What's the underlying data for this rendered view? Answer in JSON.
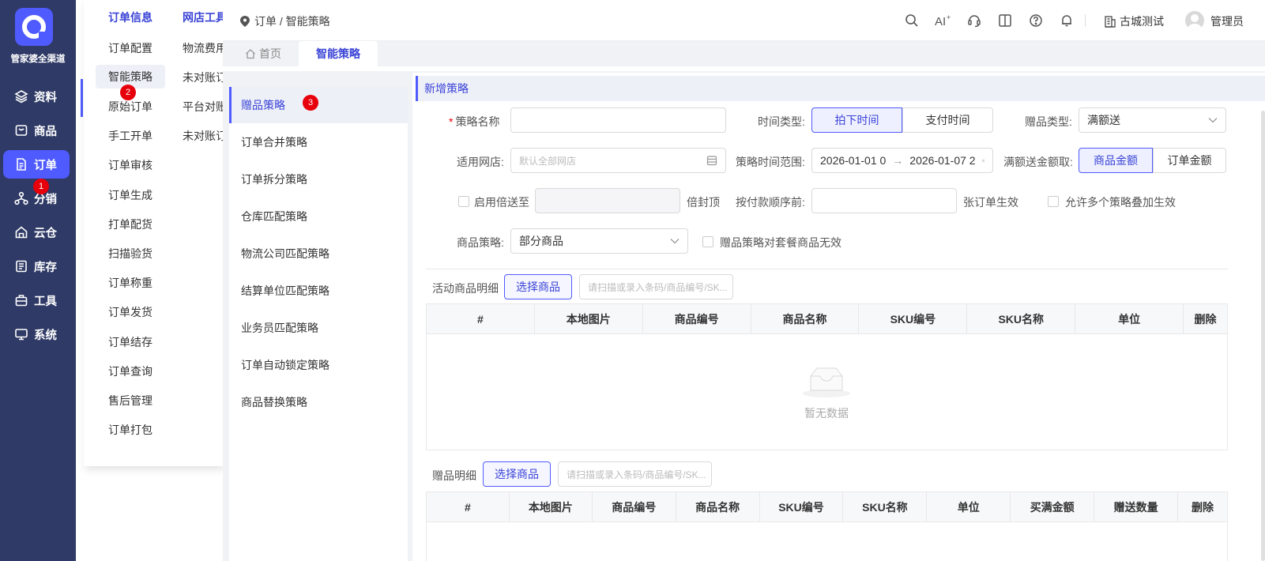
{
  "brand": {
    "name": "管家婆全渠道"
  },
  "sidenav": {
    "items": [
      {
        "label": "资料",
        "icon": "layers-icon"
      },
      {
        "label": "商品",
        "icon": "goods-icon"
      },
      {
        "label": "订单",
        "icon": "order-icon",
        "active": true
      },
      {
        "label": "分销",
        "icon": "distribution-icon"
      },
      {
        "label": "云仓",
        "icon": "cloud-warehouse-icon"
      },
      {
        "label": "库存",
        "icon": "inventory-icon"
      },
      {
        "label": "工具",
        "icon": "toolbox-icon"
      },
      {
        "label": "系统",
        "icon": "monitor-icon"
      }
    ]
  },
  "badges": {
    "b1": "1",
    "b2": "2",
    "b3": "3"
  },
  "menu": {
    "col1": {
      "title": "订单信息",
      "items": [
        "订单配置",
        "智能策略",
        "原始订单",
        "手工开单",
        "订单审核",
        "订单生成",
        "打单配货",
        "扫描验货",
        "订单称重",
        "订单发货",
        "订单结存",
        "订单查询",
        "售后管理",
        "订单打包"
      ]
    },
    "col2": {
      "title": "网店工具",
      "items": [
        "物流费用",
        "未对账订",
        "平台对账",
        "未对账订"
      ]
    }
  },
  "topbar": {
    "breadcrumb": "订单 / 智能策略",
    "shop": "古城测试",
    "user": "管理员",
    "icons": [
      "search-icon",
      "ai-icon",
      "support-icon",
      "book-icon",
      "help-icon",
      "bell-icon",
      "building-icon"
    ]
  },
  "tabs": [
    {
      "label": "首页",
      "icon": "home-icon"
    },
    {
      "label": "智能策略",
      "active": true
    }
  ],
  "strategies": [
    "赠品策略",
    "订单合并策略",
    "订单拆分策略",
    "仓库匹配策略",
    "物流公司匹配策略",
    "结算单位匹配策略",
    "业务员匹配策略",
    "订单自动锁定策略",
    "商品替换策略"
  ],
  "form": {
    "header": "新增策略",
    "name_label": "策略名称",
    "name_value": "",
    "time_type_label": "时间类型:",
    "time_type_options": [
      "拍下时间",
      "支付时间"
    ],
    "gift_type_label": "赠品类型:",
    "gift_type_value": "满额送",
    "shop_label": "适用网店:",
    "shop_placeholder": "默认全部网店",
    "range_label": "策略时间范围:",
    "range_start": "2026-01-01 0",
    "range_arrow": "→",
    "range_end": "2026-01-07 2",
    "amount_label": "满额送金额取:",
    "amount_options": [
      "商品金额",
      "订单金额"
    ],
    "multiply_label": "启用倍送至",
    "cap_label": "倍封顶",
    "pay_order_label": "按付款顺序前:",
    "pay_order_suffix": "张订单生效",
    "stack_label": "允许多个策略叠加生效",
    "goods_strategy_label": "商品策略:",
    "goods_strategy_value": "部分商品",
    "combo_label": "赠品策略对套餐商品无效"
  },
  "activity_goods": {
    "label": "活动商品明细",
    "select_button": "选择商品",
    "search_placeholder": "请扫描或录入条码/商品编号/SK...",
    "columns": [
      "#",
      "本地图片",
      "商品编号",
      "商品名称",
      "SKU编号",
      "SKU名称",
      "单位",
      "删除"
    ],
    "empty_text": "暂无数据"
  },
  "gift_goods": {
    "label": "赠品明细",
    "select_button": "选择商品",
    "search_placeholder": "请扫描或录入条码/商品编号/SK...",
    "columns": [
      "#",
      "本地图片",
      "商品编号",
      "商品名称",
      "SKU编号",
      "SKU名称",
      "单位",
      "买满金额",
      "赠送数量",
      "删除"
    ]
  }
}
